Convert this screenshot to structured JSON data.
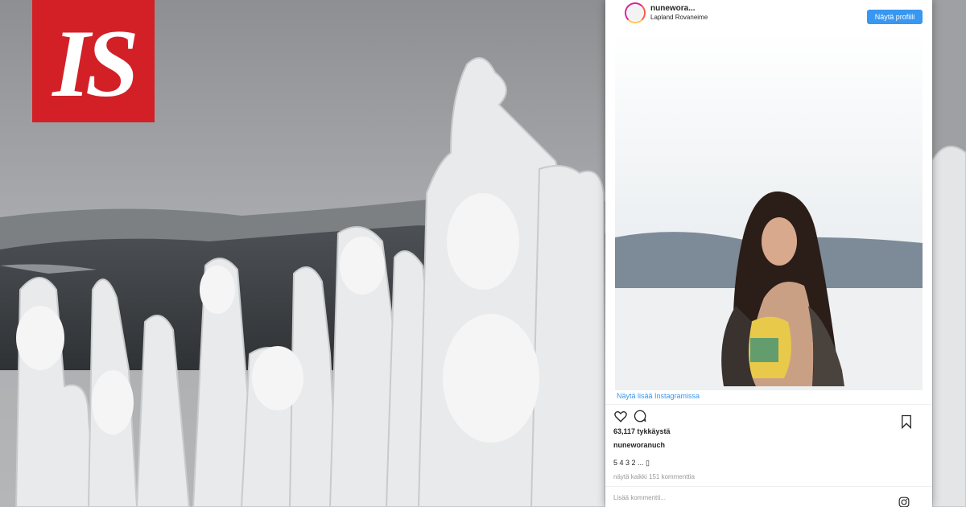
{
  "brand": {
    "logo_text": "IS",
    "color": "#d32027"
  },
  "post": {
    "username": "nunewora...",
    "location": "Lapland Rovaneime",
    "profile_button": "Näytä profiili",
    "more_on_instagram": "Näytä lisää Instagramissa",
    "likes": "63,117 tykkäystä",
    "caption_user": "nuneworanuch",
    "caption_text": "5 4 3 2 ... ▯",
    "view_comments": "näytä kaikki 151 kommenttia",
    "add_comment_placeholder": "Lisää kommentti..."
  },
  "icons": {
    "like": "heart-icon",
    "comment": "comment-icon",
    "save": "bookmark-icon",
    "instagram": "instagram-icon"
  },
  "colors": {
    "accent": "#3897f0",
    "avatar_ring_start": "#d6249f",
    "avatar_ring_end": "#fdc55d"
  }
}
